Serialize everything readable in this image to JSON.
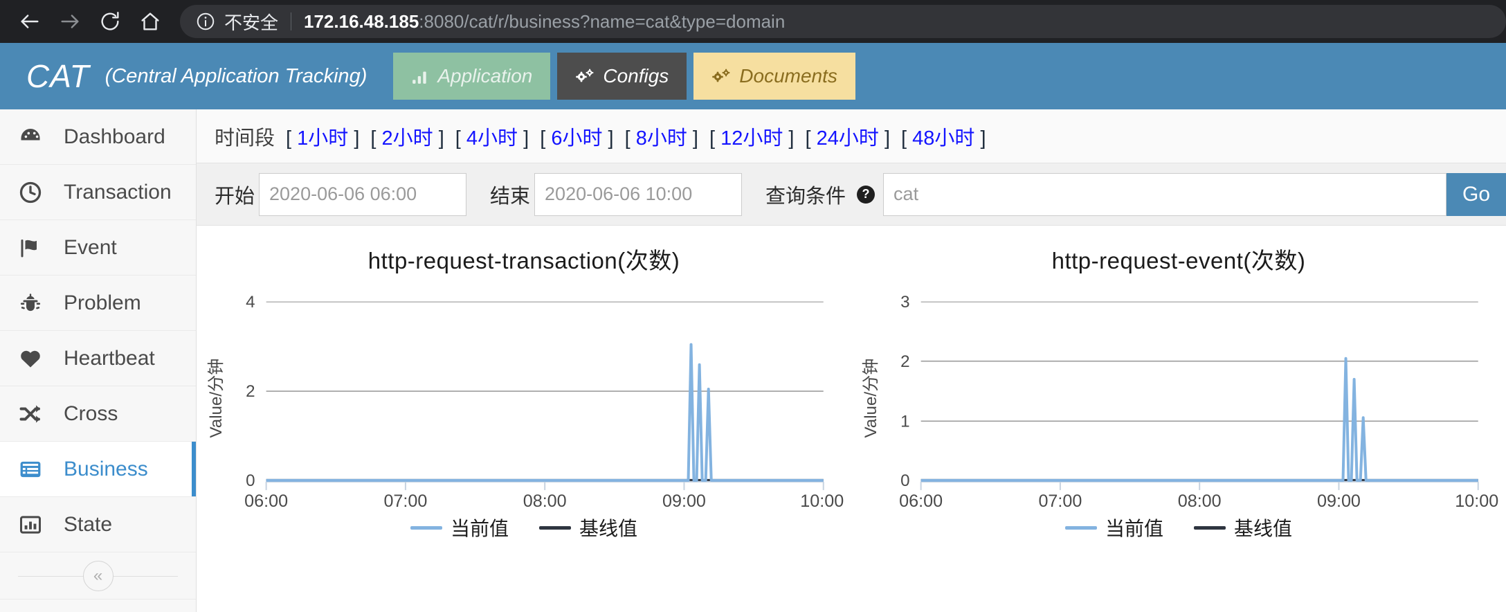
{
  "browser": {
    "back_icon": "arrow-left-icon",
    "forward_icon": "arrow-right-icon",
    "reload_icon": "reload-icon",
    "home_icon": "home-icon",
    "info_icon": "info-circle-icon",
    "security_label": "不安全",
    "url_host": "172.16.48.185",
    "url_rest": ":8080/cat/r/business?name=cat&type=domain"
  },
  "header": {
    "brand": "CAT",
    "brand_sub": "(Central Application Tracking)",
    "tabs": [
      {
        "label": "Application",
        "icon": "bar-chart-icon"
      },
      {
        "label": "Configs",
        "icon": "gears-icon"
      },
      {
        "label": "Documents",
        "icon": "gears-icon"
      }
    ]
  },
  "sidebar": {
    "items": [
      {
        "label": "Dashboard",
        "icon": "dashboard-gauge-icon",
        "active": false
      },
      {
        "label": "Transaction",
        "icon": "clock-icon",
        "active": false
      },
      {
        "label": "Event",
        "icon": "flag-icon",
        "active": false
      },
      {
        "label": "Problem",
        "icon": "bug-icon",
        "active": false
      },
      {
        "label": "Heartbeat",
        "icon": "heart-icon",
        "active": false
      },
      {
        "label": "Cross",
        "icon": "shuffle-icon",
        "active": false
      },
      {
        "label": "Business",
        "icon": "list-panel-icon",
        "active": true
      },
      {
        "label": "State",
        "icon": "bar-chart-box-icon",
        "active": false
      }
    ],
    "collapse_label": "«",
    "collapse_icon": "chevron-double-left-icon"
  },
  "filters": {
    "period_label": "时间段",
    "ranges": [
      "1小时",
      "2小时",
      "4小时",
      "6小时",
      "8小时",
      "12小时",
      "24小时",
      "48小时"
    ],
    "bracket_open": "[",
    "bracket_close": "]",
    "start_label": "开始",
    "start_value": "2020-06-06 06:00",
    "end_label": "结束",
    "end_value": "2020-06-06 10:00",
    "condition_label": "查询条件",
    "help_icon": "question-mark-icon",
    "help_glyph": "?",
    "condition_value": "cat",
    "go_label": "Go"
  },
  "colors": {
    "header_blue": "#4b89b5",
    "accent_blue": "#3c8dcc",
    "series_current": "#83b3e0",
    "series_baseline": "#2f3540",
    "tab_application": "#8ec1a2",
    "tab_configs": "#4d4d4d",
    "tab_documents": "#f6dfa0",
    "link_blue": "#1414ff"
  },
  "chart_data": [
    {
      "type": "line",
      "title": "http-request-transaction(次数)",
      "xlabel": "",
      "ylabel": "Value/分钟",
      "ylim": [
        0,
        4
      ],
      "yticks": [
        0,
        2,
        4
      ],
      "xticks": [
        "06:00",
        "07:00",
        "08:00",
        "09:00",
        "10:00"
      ],
      "grid": true,
      "legend_position": "bottom",
      "series": [
        {
          "name": "当前值",
          "color": "#83b3e0",
          "points": [
            {
              "x": "06:00",
              "y": 0
            },
            {
              "x": "09:02",
              "y": 0
            },
            {
              "x": "09:04",
              "y": 3.05
            },
            {
              "x": "09:06",
              "y": 0
            },
            {
              "x": "09:07",
              "y": 0
            },
            {
              "x": "09:08",
              "y": 2.6
            },
            {
              "x": "09:09",
              "y": 0
            },
            {
              "x": "09:11",
              "y": 0
            },
            {
              "x": "09:13",
              "y": 2.05
            },
            {
              "x": "09:15",
              "y": 0
            },
            {
              "x": "10:00",
              "y": 0
            }
          ]
        },
        {
          "name": "基线值",
          "color": "#2f3540",
          "points": [
            {
              "x": "06:00",
              "y": 0
            },
            {
              "x": "10:00",
              "y": 0
            }
          ]
        }
      ]
    },
    {
      "type": "line",
      "title": "http-request-event(次数)",
      "xlabel": "",
      "ylabel": "Value/分钟",
      "ylim": [
        0,
        3
      ],
      "yticks": [
        0,
        1,
        2,
        3
      ],
      "xticks": [
        "06:00",
        "07:00",
        "08:00",
        "09:00",
        "10:00"
      ],
      "grid": true,
      "legend_position": "bottom",
      "series": [
        {
          "name": "当前值",
          "color": "#83b3e0",
          "points": [
            {
              "x": "06:00",
              "y": 0
            },
            {
              "x": "09:02",
              "y": 0
            },
            {
              "x": "09:04",
              "y": 2.05
            },
            {
              "x": "09:06",
              "y": 0
            },
            {
              "x": "09:07",
              "y": 0
            },
            {
              "x": "09:08",
              "y": 1.7
            },
            {
              "x": "09:09",
              "y": 0
            },
            {
              "x": "09:11",
              "y": 0
            },
            {
              "x": "09:13",
              "y": 1.05
            },
            {
              "x": "09:15",
              "y": 0
            },
            {
              "x": "10:00",
              "y": 0
            }
          ]
        },
        {
          "name": "基线值",
          "color": "#2f3540",
          "points": [
            {
              "x": "06:00",
              "y": 0
            },
            {
              "x": "10:00",
              "y": 0
            }
          ]
        }
      ]
    }
  ]
}
